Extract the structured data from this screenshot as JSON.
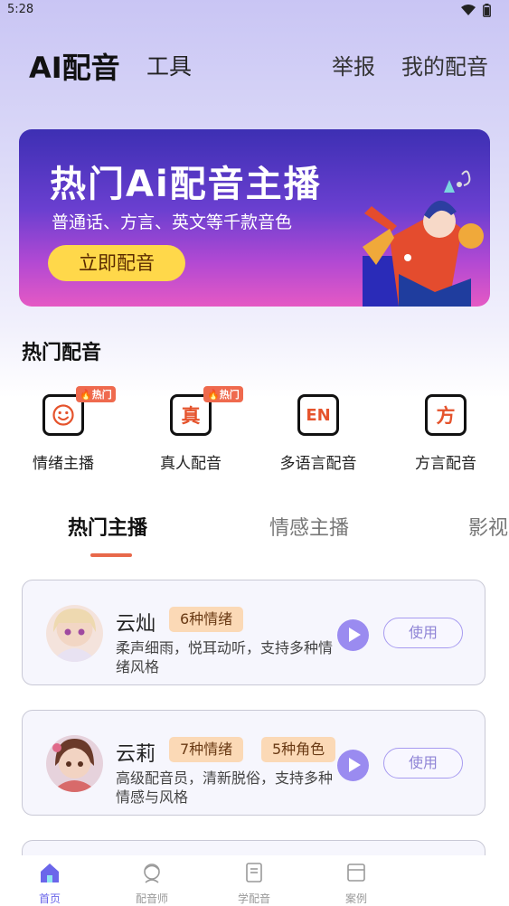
{
  "status_bar": {
    "time": "5:28"
  },
  "header": {
    "title": "AI配音",
    "tools": "工具",
    "report": "举报",
    "my_dubbing": "我的配音"
  },
  "banner": {
    "title": "热门Ai配音主播",
    "subtitle": "普通话、方言、英文等千款音色",
    "button": "立即配音"
  },
  "hot_section": {
    "title": "热门配音",
    "categories": [
      {
        "label": "情绪主播",
        "badge": "热门",
        "icon": "smiley-icon",
        "icon_text": ""
      },
      {
        "label": "真人配音",
        "badge": "热门",
        "icon": "zhen-icon",
        "icon_text": "真"
      },
      {
        "label": "多语言配音",
        "badge": "",
        "icon": "en-icon",
        "icon_text": "EN"
      },
      {
        "label": "方言配音",
        "badge": "",
        "icon": "fang-icon",
        "icon_text": "方"
      }
    ]
  },
  "tabs": [
    {
      "label": "热门主播",
      "active": true
    },
    {
      "label": "情感主播"
    },
    {
      "label": "影视"
    }
  ],
  "anchors": [
    {
      "name": "云灿",
      "tags": [
        "6种情绪"
      ],
      "description": "柔声细雨，悦耳动听，支持多种情绪风格",
      "button": "使用"
    },
    {
      "name": "云莉",
      "tags": [
        "7种情绪",
        "5种角色"
      ],
      "description": "高级配音员，清新脱俗，支持多种情感与风格",
      "button": "使用"
    }
  ],
  "bottom_nav": [
    {
      "label": "首页",
      "icon": "home-icon",
      "active": true
    },
    {
      "label": "配音师",
      "icon": "voice-actor-icon"
    },
    {
      "label": "学配音",
      "icon": "learn-icon"
    },
    {
      "label": "案例",
      "icon": "case-icon"
    }
  ],
  "colors": {
    "accent": "#6b66ea",
    "tag_bg": "#fbd9b6",
    "hot_badge": "#ef6a4e",
    "banner_button": "#ffd84a"
  }
}
